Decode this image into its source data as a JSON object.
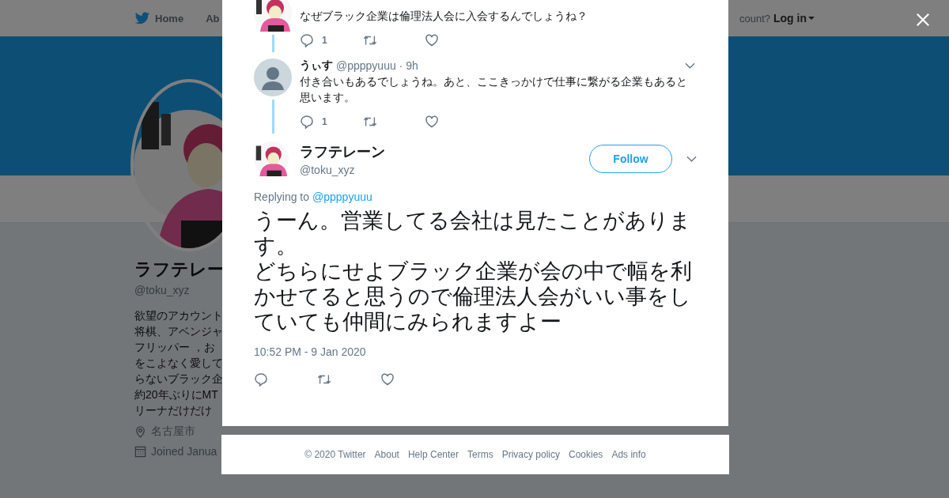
{
  "nav": {
    "home": "Home",
    "about": "Ab",
    "login_prompt": "count?",
    "login": "Log in"
  },
  "profile": {
    "name": "ラフテレー",
    "handle": "@toku_xyz",
    "bio_lines": [
      "欲望のアカウント",
      "将棋、アベンジャ",
      "フリッパー ，お",
      "をこよなく愛して",
      "らないブラック企",
      "約20年ぶりにMT",
      "リーナだけだけ"
    ],
    "location": "名古屋市",
    "joined": "Joined Janua"
  },
  "thread": [
    {
      "kind": "picture_avatar",
      "text": "なぜブラック企業は倫理法人会に入会するんでしょうね？",
      "replies": "1"
    },
    {
      "kind": "default_avatar",
      "name": "うぃす",
      "handle_time": "@ppppyuuu · 9h",
      "text": "付き合いもあるでしょうね。あと、ここきっかけで仕事に繋がる企業もあると思います。",
      "replies": "1"
    }
  ],
  "main_tweet": {
    "name": "ラフテレーン",
    "handle": "@toku_xyz",
    "follow": "Follow",
    "replying_label": "Replying to",
    "replying_to": "@ppppyuuu",
    "paragraphs": [
      "うーん。営業してる会社は見たことがあります。",
      "どちらにせよブラック企業が会の中で幅を利かせてると思うので倫理法人会がいい事をしていても仲間にみられますよー"
    ],
    "time": "10:52 PM - 9 Jan 2020"
  },
  "footer": [
    "© 2020 Twitter",
    "About",
    "Help Center",
    "Terms",
    "Privacy policy",
    "Cookies",
    "Ads info"
  ]
}
